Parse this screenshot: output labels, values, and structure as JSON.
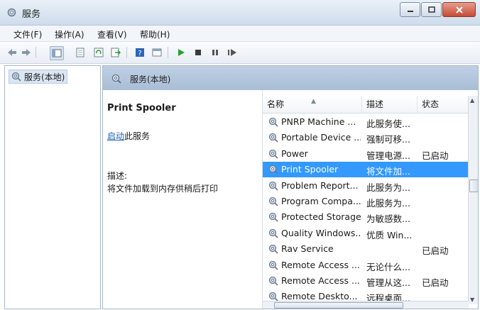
{
  "window": {
    "title": "服务"
  },
  "menu": [
    "文件(F)",
    "操作(A)",
    "查看(V)",
    "帮助(H)"
  ],
  "tree": {
    "root_label": "服务(本地)"
  },
  "right_header": {
    "label": "服务(本地)"
  },
  "detail": {
    "service_name": "Print Spooler",
    "action_link": "启动",
    "action_suffix": "此服务",
    "description_label": "描述:",
    "description_text": "将文件加载到内存供稍后打印"
  },
  "columns": {
    "name": "名称",
    "desc": "描述",
    "status": "状态"
  },
  "rows": [
    {
      "name": "PNRP Machine ...",
      "desc": "此服务使...",
      "status": ""
    },
    {
      "name": "Portable Device ...",
      "desc": "强制可移...",
      "status": ""
    },
    {
      "name": "Power",
      "desc": "管理电源...",
      "status": "已启动"
    },
    {
      "name": "Print Spooler",
      "desc": "将文件加...",
      "status": ""
    },
    {
      "name": "Problem Report...",
      "desc": "此服务为...",
      "status": ""
    },
    {
      "name": "Program Compa...",
      "desc": "此服务为...",
      "status": ""
    },
    {
      "name": "Protected Storage",
      "desc": "为敏感数...",
      "status": ""
    },
    {
      "name": "Quality Windows...",
      "desc": "优质 Win...",
      "status": ""
    },
    {
      "name": "Rav Service",
      "desc": "",
      "status": "已启动"
    },
    {
      "name": "Remote Access ...",
      "desc": "无论什么...",
      "status": ""
    },
    {
      "name": "Remote Access ...",
      "desc": "管理从这...",
      "status": "已启动"
    },
    {
      "name": "Remote Deskto...",
      "desc": "远程桌面...",
      "status": ""
    }
  ],
  "selected_index": 3,
  "colors": {
    "selection": "#3399ff",
    "link": "#1c5fb8"
  }
}
